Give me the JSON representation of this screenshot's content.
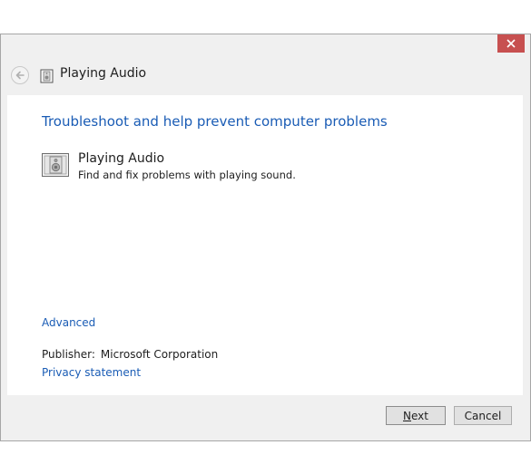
{
  "window": {
    "title": "Playing Audio"
  },
  "content": {
    "heading": "Troubleshoot and help prevent computer problems",
    "item": {
      "title": "Playing Audio",
      "description": "Find and fix problems with playing sound."
    },
    "advanced_link": "Advanced",
    "publisher_label": "Publisher:",
    "publisher_value": "Microsoft Corporation",
    "privacy_link": "Privacy statement"
  },
  "buttons": {
    "next": "Next",
    "cancel": "Cancel"
  },
  "colors": {
    "link": "#1a5cb5",
    "close_button": "#c75050",
    "dialog_background": "#f0f0f0"
  },
  "icons": [
    "close-icon",
    "back-arrow-icon",
    "speaker-troubleshooter-icon"
  ]
}
